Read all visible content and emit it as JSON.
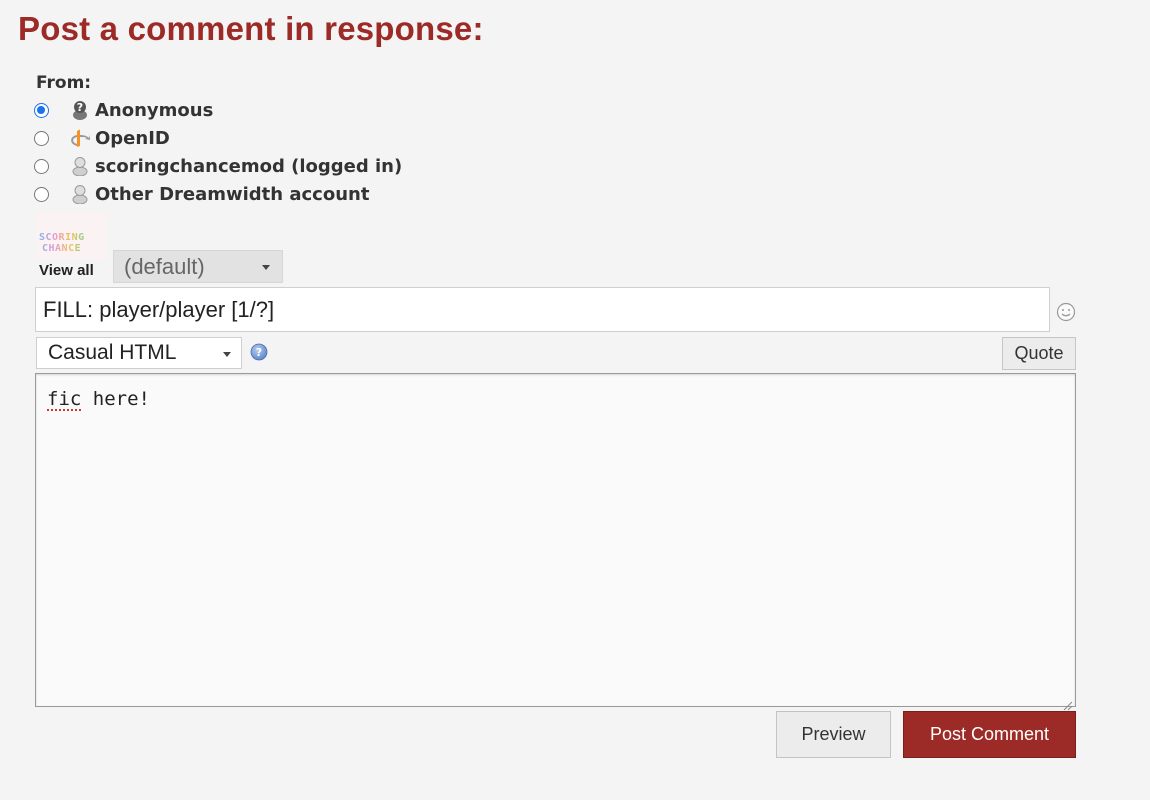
{
  "page_title": "Post a comment in response:",
  "from": {
    "label": "From:",
    "options": [
      {
        "label": "Anonymous",
        "icon": "anonymous-icon",
        "checked": true
      },
      {
        "label": "OpenID",
        "icon": "openid-icon",
        "checked": false
      },
      {
        "label": "scoringchancemod (logged in)",
        "icon": "user-icon",
        "checked": false
      },
      {
        "label": "Other Dreamwidth account",
        "icon": "user-icon",
        "checked": false
      }
    ]
  },
  "userpic": {
    "text_line1": "SCORING",
    "text_line2": "CHANCE",
    "view_all": "View all",
    "selected": "(default)"
  },
  "subject": {
    "value": "FILL: player/player [1/?]"
  },
  "editor": {
    "format": "Casual HTML",
    "quote_label": "Quote",
    "body_word1": "fic",
    "body_rest": " here!"
  },
  "actions": {
    "preview_label": "Preview",
    "post_label": "Post Comment"
  },
  "colors": {
    "accent": "#9c2a27",
    "radio_checked": "#1a73e8"
  }
}
